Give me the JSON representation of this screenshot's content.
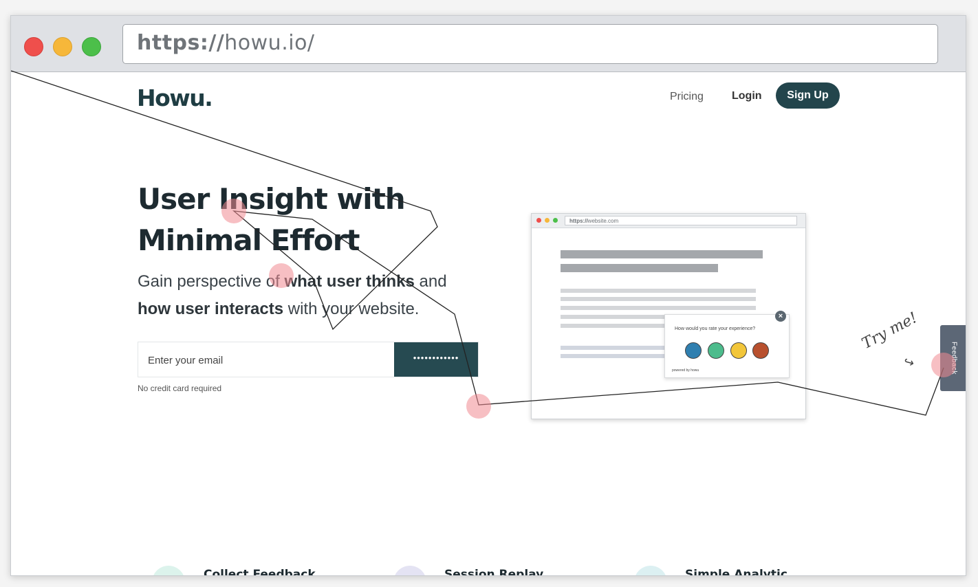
{
  "browser": {
    "url_scheme": "https://",
    "url_rest": "howu.io/"
  },
  "nav": {
    "logo": "Howu.",
    "pricing": "Pricing",
    "login": "Login",
    "signup": "Sign Up"
  },
  "hero": {
    "title_line1": "User Insight with",
    "title_line2": "Minimal Effort",
    "sub_part1": "Gain perspective of ",
    "sub_bold1": "what user thinks",
    "sub_part2": " and ",
    "sub_bold2": "how user interacts",
    "sub_part3": " with your website.",
    "email_placeholder": "Enter your email",
    "submit_masked": "••••••••••••",
    "fine_print": "No credit card required"
  },
  "mockup": {
    "url_scheme": "https://",
    "url_rest": "website.com",
    "survey_question": "How would you rate your experience?",
    "close_glyph": "×",
    "powered_by": "powered by howu",
    "faces": [
      {
        "name": "face-very-unhappy",
        "color": "#2f7fb0"
      },
      {
        "name": "face-neutral",
        "color": "#4cbc8c"
      },
      {
        "name": "face-happy",
        "color": "#f2c63a"
      },
      {
        "name": "face-angry",
        "color": "#b8502e"
      }
    ]
  },
  "side": {
    "try_me": "Try me!",
    "feedback_tab": "Feedback"
  },
  "features": [
    {
      "title": "Collect Feedback",
      "icon_color": "#dcf3ec"
    },
    {
      "title": "Session Replay",
      "icon_color": "#e4e3f3"
    },
    {
      "title": "Simple Analytic",
      "icon_color": "#dcf0f2"
    }
  ],
  "colors": {
    "brand_dark": "#23454c",
    "click_marker": "#f08a92"
  }
}
